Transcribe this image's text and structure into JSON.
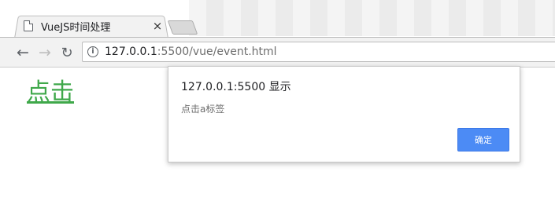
{
  "browser": {
    "tab": {
      "title": "VueJS时间处理",
      "close_glyph": "×"
    },
    "nav": {
      "back_glyph": "←",
      "forward_glyph": "→",
      "reload_glyph": "↻"
    },
    "address": {
      "host": "127.0.0.1",
      "rest": ":5500/vue/event.html",
      "info_glyph": "i"
    }
  },
  "page": {
    "link_text": "点击"
  },
  "dialog": {
    "title": "127.0.0.1:5500 显示",
    "message": "点击a标签",
    "ok_label": "确定"
  },
  "colors": {
    "link": "#3fa84a",
    "ok_button": "#4c8bf5"
  }
}
